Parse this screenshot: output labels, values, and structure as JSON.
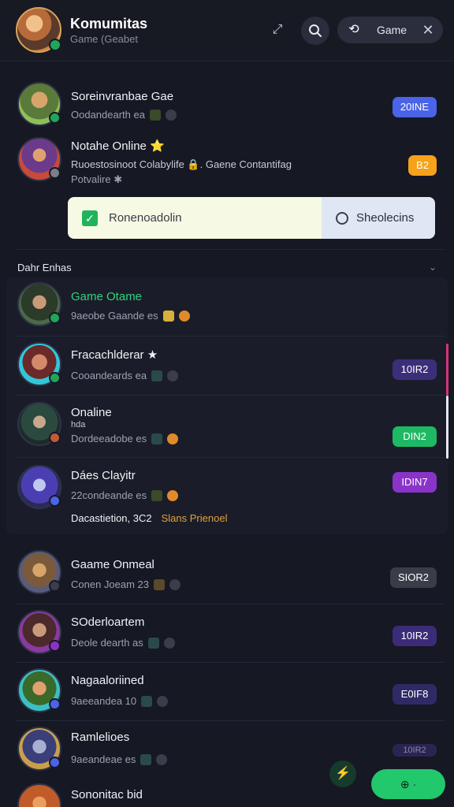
{
  "header": {
    "title": "Komumitas",
    "subtitle": "Game (Geabet",
    "chip_label": "Game",
    "icons": [
      "link-icon",
      "search-icon",
      "game-icon",
      "close-icon"
    ]
  },
  "pinned": [
    {
      "name": "Soreinvranbae Gae",
      "sub": "Oodandearth ea",
      "badge": "20INE",
      "badge_color": "#4b63e8",
      "avatar_color": "#5a7a3a"
    },
    {
      "name": "Notahe Online ⭐",
      "sub": "Ruoestosinoot Colabylife 🔒. Gaene Contantifag",
      "sub2": "Potvalire ✱",
      "badge": "B2",
      "badge_color": "#f6a21b",
      "avatar_color": "#6b3a8a"
    }
  ],
  "actions": {
    "left_label": "Ronenoadolin",
    "right_label": "Sheolecins"
  },
  "section": {
    "title": "Dahr Enhas",
    "chevron": "⌄"
  },
  "group": [
    {
      "name": "Game Otame",
      "sub": "9aeobe Gaande es",
      "badge": "",
      "name_color": "#2fd27f",
      "avatar_color": "#2c3a2a"
    },
    {
      "name": "Fracachlderar ★",
      "sub": "Cooandeards ea",
      "badge": "10IR2",
      "badge_color": "#3c2f7a",
      "avatar_color": "#31c7d9"
    },
    {
      "name": "Onaline",
      "sub2": "hda",
      "sub": "Dordeeadobe es",
      "badge": "DIN2",
      "badge_color": "#1fb865",
      "avatar_color": "#2a4a40"
    },
    {
      "name": "Dáes Clayitr",
      "sub": "22condeande es",
      "sub3": "Dacastietion, 3C2",
      "sub3_tag": "Slans   Prienoel",
      "badge": "IDIN7",
      "badge_color": "#8a33c9",
      "avatar_color": "#4a3fb2"
    }
  ],
  "list": [
    {
      "name": "Gaame Onmeal",
      "sub": "Conen Joeam 23",
      "badge": "SIOR2",
      "badge_color": "#3a3c48",
      "avatar_color": "#5a5b7a"
    },
    {
      "name": "SOderloartem",
      "sub": "Deole dearth as",
      "badge": "10IR2",
      "badge_color": "#3c2b78",
      "avatar_color": "#8a3aa0"
    },
    {
      "name": "Nagaaloriined",
      "sub": "9aeeandea 10",
      "badge": "E0IF8",
      "badge_color": "#2f2a66",
      "avatar_color": "#39c0c7"
    },
    {
      "name": "Ramlelioes",
      "sub": "9aeandeae es",
      "badge": "10IR2",
      "badge_color": "#2a2550",
      "avatar_color": "#3a3f7a"
    },
    {
      "name": "Sononitac bid",
      "sub": "",
      "badge": "",
      "avatar_color": "#c25b2a"
    }
  ],
  "fab": {
    "label": "⊕ ·"
  }
}
